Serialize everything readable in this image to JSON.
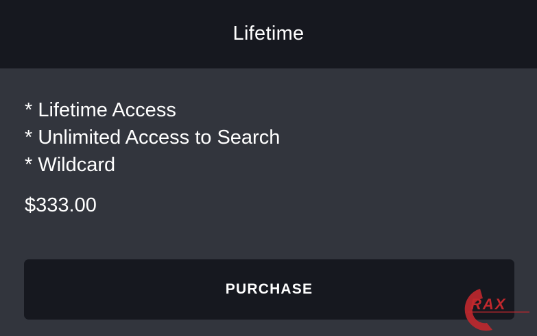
{
  "header": {
    "title": "Lifetime"
  },
  "plan": {
    "features": [
      "* Lifetime Access",
      "* Unlimited Access to Search",
      "* Wildcard"
    ],
    "price": "$333.00"
  },
  "actions": {
    "purchase_label": "PURCHASE"
  },
  "watermark": {
    "text": "RAX",
    "color": "#c0282d"
  },
  "colors": {
    "header_bg": "#16181f",
    "body_bg": "#32353d",
    "button_bg": "#16181f",
    "text": "#ffffff"
  }
}
